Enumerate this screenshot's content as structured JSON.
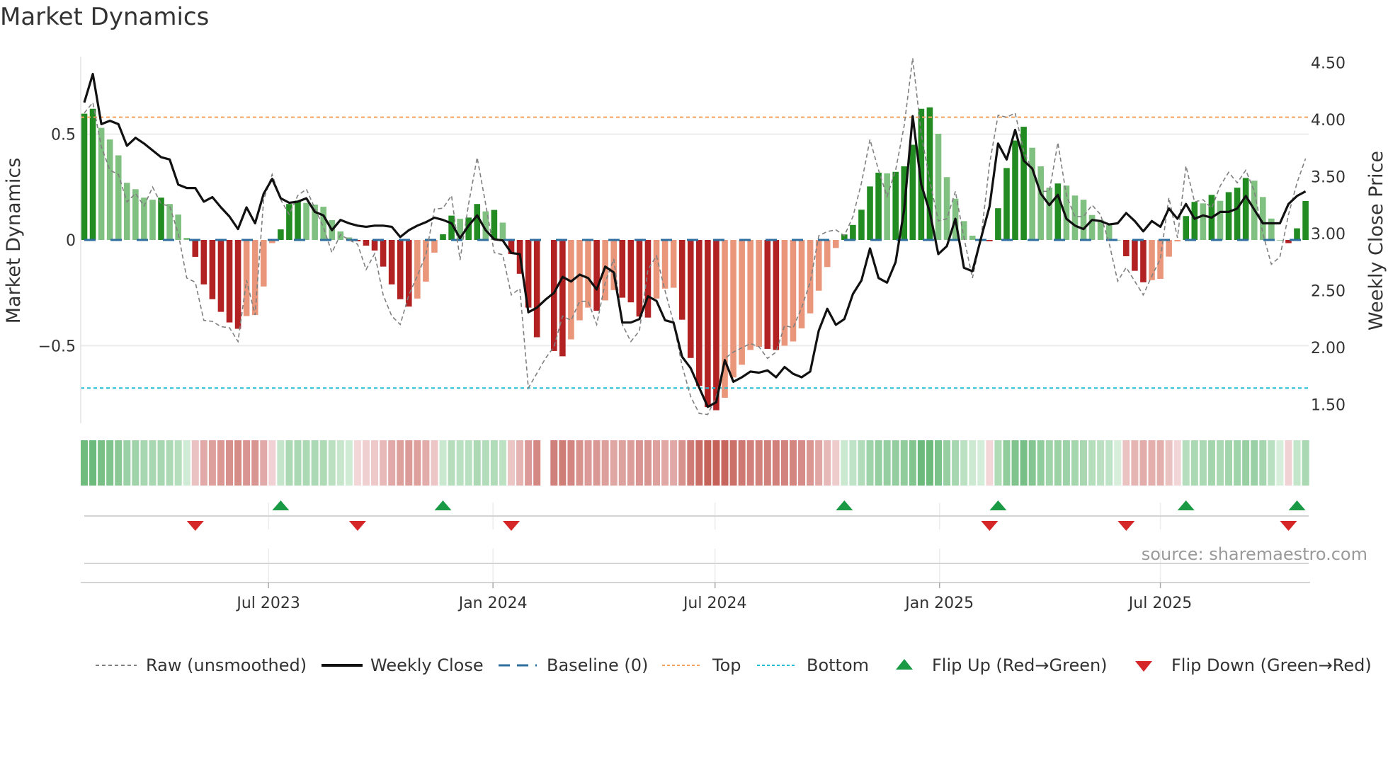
{
  "title": "Market Dynamics",
  "source": "source: sharemaestro.com",
  "colors": {
    "strong_green": "#228b22",
    "weak_green": "#80c080",
    "strong_red": "#b22222",
    "weak_red": "#e9967a",
    "baseline": "#2f6f9f",
    "top": "#f4a460",
    "bottom": "#22bcd4",
    "flip_up": "#1a9a45",
    "flip_down": "#d62728",
    "close": "#111111",
    "raw": "#808080"
  },
  "legend": {
    "raw": "Raw (unsmoothed)",
    "close": "Weekly Close",
    "baseline": "Baseline (0)",
    "top": "Top",
    "bottom": "Bottom",
    "flip_up": "Flip Up (Red→Green)",
    "flip_down": "Flip Down (Green→Red)"
  },
  "chart_data": {
    "type": "bar",
    "title": "Market Dynamics",
    "ylabel": "Market Dynamics",
    "ylabel_right": "Weekly Close Price",
    "x_start": "2023-01-31",
    "x_step_days": 7,
    "ylim": [
      -0.87,
      0.86
    ],
    "ylim_right": [
      1.33,
      4.54
    ],
    "yticks": [
      {
        "value": 0.5,
        "label": "0.5"
      },
      {
        "value": 0,
        "label": "0"
      },
      {
        "value": -0.5,
        "label": "−0.5"
      }
    ],
    "yticks_right": [
      {
        "value": 4.5,
        "label": "4.50"
      },
      {
        "value": 4.0,
        "label": "4.00"
      },
      {
        "value": 3.5,
        "label": "3.50"
      },
      {
        "value": 3.0,
        "label": "3.00"
      },
      {
        "value": 2.5,
        "label": "2.50"
      },
      {
        "value": 2.0,
        "label": "2.00"
      },
      {
        "value": 1.5,
        "label": "1.50"
      }
    ],
    "xticks": [
      {
        "date": "2023-07-01",
        "label": "Jul 2023"
      },
      {
        "date": "2024-01-01",
        "label": "Jan 2024"
      },
      {
        "date": "2024-07-01",
        "label": "Jul 2024"
      },
      {
        "date": "2025-01-01",
        "label": "Jan 2025"
      },
      {
        "date": "2025-07-01",
        "label": "Jul 2025"
      }
    ],
    "top_level": 0.58,
    "bottom_level": -0.7,
    "baseline": 0,
    "grid": true,
    "legend_position": "bottom",
    "values": [
      0.597,
      0.62,
      0.53,
      0.475,
      0.4,
      0.27,
      0.24,
      0.2,
      0.19,
      0.2,
      0.17,
      0.12,
      0.01,
      -0.08,
      -0.21,
      -0.28,
      -0.34,
      -0.39,
      -0.42,
      -0.36,
      -0.355,
      -0.22,
      -0.015,
      0.05,
      0.17,
      0.186,
      0.175,
      0.167,
      0.157,
      0.094,
      0.04,
      0.012,
      -0.006,
      -0.027,
      -0.05,
      -0.126,
      -0.21,
      -0.28,
      -0.315,
      -0.277,
      -0.197,
      -0.06,
      0.027,
      0.115,
      0.1,
      0.106,
      0.17,
      0.135,
      0.142,
      0.082,
      -0.067,
      -0.16,
      -0.32,
      -0.46,
      null,
      -0.525,
      -0.55,
      -0.47,
      -0.38,
      -0.32,
      -0.335,
      -0.286,
      -0.237,
      -0.273,
      -0.295,
      -0.362,
      -0.367,
      -0.277,
      -0.23,
      -0.226,
      -0.377,
      -0.558,
      -0.69,
      -0.79,
      -0.805,
      -0.746,
      -0.65,
      -0.59,
      -0.52,
      -0.505,
      -0.515,
      -0.52,
      -0.5,
      -0.48,
      -0.418,
      -0.347,
      -0.24,
      -0.128,
      -0.038,
      0.026,
      0.071,
      0.143,
      0.253,
      0.318,
      0.315,
      0.322,
      0.348,
      0.45,
      0.62,
      0.627,
      0.502,
      0.297,
      0.195,
      0.089,
      0.02,
      0.003,
      -0.006,
      0.15,
      0.34,
      0.47,
      0.535,
      0.436,
      0.348,
      0.247,
      0.267,
      0.257,
      0.21,
      0.19,
      0.118,
      0.095,
      0.07,
      0,
      -0.077,
      -0.146,
      -0.2,
      -0.19,
      -0.184,
      -0.079,
      -0.007,
      0.113,
      0.18,
      0.173,
      0.213,
      0.185,
      0.226,
      0.247,
      0.293,
      0.28,
      0.203,
      0.101,
      0,
      -0.015,
      0.055,
      0.184
    ],
    "strong": [
      1,
      1,
      0,
      0,
      0,
      0,
      0,
      0,
      0,
      1,
      0,
      0,
      0,
      1,
      1,
      1,
      1,
      1,
      1,
      0,
      0,
      0,
      0,
      1,
      1,
      1,
      0,
      0,
      0,
      0,
      0,
      0,
      1,
      1,
      1,
      1,
      1,
      1,
      1,
      0,
      0,
      0,
      1,
      1,
      0,
      1,
      1,
      0,
      1,
      0,
      1,
      1,
      1,
      1,
      0,
      1,
      1,
      0,
      0,
      0,
      1,
      0,
      0,
      1,
      1,
      1,
      1,
      0,
      0,
      0,
      1,
      1,
      1,
      1,
      1,
      0,
      0,
      0,
      0,
      0,
      1,
      1,
      0,
      0,
      0,
      0,
      0,
      0,
      0,
      1,
      1,
      1,
      1,
      1,
      0,
      1,
      1,
      1,
      1,
      1,
      0,
      0,
      0,
      0,
      0,
      0,
      1,
      1,
      1,
      1,
      1,
      0,
      0,
      0,
      1,
      0,
      0,
      0,
      0,
      0,
      0,
      0,
      1,
      1,
      1,
      0,
      0,
      0,
      0,
      1,
      1,
      0,
      1,
      0,
      1,
      1,
      1,
      0,
      0,
      0,
      0,
      1,
      1,
      1
    ],
    "raw": [
      0.6,
      0.65,
      0.44,
      0.33,
      0.31,
      0.18,
      0.22,
      0.16,
      0.25,
      0.17,
      0.16,
      0.03,
      -0.18,
      -0.2,
      -0.38,
      -0.385,
      -0.41,
      -0.415,
      -0.48,
      -0.19,
      -0.355,
      0.19,
      0.31,
      0.19,
      0.12,
      0.21,
      0.24,
      0.15,
      0.06,
      -0.06,
      0.025,
      0,
      -0.02,
      -0.14,
      -0.065,
      -0.26,
      -0.36,
      -0.4,
      -0.26,
      -0.17,
      -0.07,
      0.146,
      0.15,
      0.21,
      -0.095,
      0.17,
      0.39,
      0.17,
      -0.06,
      -0.07,
      -0.26,
      -0.23,
      -0.7,
      -0.63,
      -0.56,
      -0.505,
      -0.36,
      -0.38,
      -0.29,
      -0.29,
      -0.4,
      -0.2,
      -0.09,
      -0.4,
      -0.48,
      -0.43,
      -0.14,
      -0.075,
      -0.24,
      -0.39,
      -0.595,
      -0.74,
      -0.82,
      -0.825,
      -0.74,
      -0.56,
      -0.53,
      -0.51,
      -0.49,
      -0.505,
      -0.56,
      -0.53,
      -0.405,
      -0.415,
      -0.32,
      -0.2,
      0.02,
      0.04,
      0.048,
      0.02,
      0.11,
      0.27,
      0.475,
      0.33,
      0.205,
      0.33,
      0.54,
      0.86,
      0.5,
      0.28,
      0.09,
      0.1,
      0.23,
      0.01,
      -0.18,
      0.01,
      0.36,
      0.59,
      0.58,
      0.6,
      0.42,
      0.33,
      0.23,
      0.23,
      0.46,
      0.21,
      0.11,
      0.11,
      0.165,
      0.12,
      -0.015,
      -0.195,
      -0.13,
      -0.195,
      -0.26,
      -0.17,
      -0.09,
      0.2,
      0.01,
      0.35,
      0.18,
      0.19,
      0.15,
      0.255,
      0.32,
      0.27,
      0.33,
      0.23,
      0.03,
      -0.115,
      -0.08,
      0.12,
      0.27,
      0.385
    ],
    "close": [
      4.15,
      4.4,
      3.96,
      3.99,
      3.96,
      3.77,
      3.84,
      3.79,
      3.73,
      3.67,
      3.65,
      3.43,
      3.4,
      3.4,
      3.28,
      3.32,
      3.23,
      3.15,
      3.04,
      3.23,
      3.09,
      3.35,
      3.48,
      3.31,
      3.27,
      3.28,
      3.31,
      3.19,
      3.16,
      3.03,
      3.12,
      3.09,
      3.07,
      3.06,
      3.07,
      3.07,
      3.06,
      2.97,
      3.03,
      3.07,
      3.1,
      3.14,
      3.12,
      3.09,
      2.96,
      3.07,
      3.16,
      3.03,
      2.95,
      2.94,
      2.83,
      2.82,
      2.31,
      2.35,
      2.42,
      2.48,
      2.62,
      2.58,
      2.64,
      2.61,
      2.51,
      2.71,
      2.66,
      2.22,
      2.22,
      2.25,
      2.45,
      2.41,
      2.24,
      2.22,
      1.92,
      1.82,
      1.65,
      1.48,
      1.52,
      1.89,
      1.7,
      1.74,
      1.79,
      1.78,
      1.8,
      1.74,
      1.83,
      1.77,
      1.74,
      1.79,
      2.15,
      2.34,
      2.2,
      2.25,
      2.47,
      2.59,
      2.87,
      2.61,
      2.57,
      2.75,
      3.21,
      4.03,
      3.43,
      3.19,
      2.82,
      2.89,
      3.13,
      2.7,
      2.67,
      2.96,
      3.24,
      3.79,
      3.65,
      3.91,
      3.64,
      3.57,
      3.35,
      3.25,
      3.34,
      3.13,
      3.07,
      3.04,
      3.12,
      3.11,
      3.08,
      3.09,
      3.18,
      3.11,
      3.02,
      3.11,
      3.06,
      3.22,
      3.13,
      3.26,
      3.13,
      3.16,
      3.14,
      3.19,
      3.19,
      3.22,
      3.33,
      3.21,
      3.09,
      3.09,
      3.09,
      3.26,
      3.33,
      3.37
    ],
    "flip_up_weeks": [
      23,
      42,
      89,
      107,
      129,
      142
    ],
    "flip_down_weeks": [
      13,
      32,
      50,
      106,
      122,
      141
    ]
  }
}
